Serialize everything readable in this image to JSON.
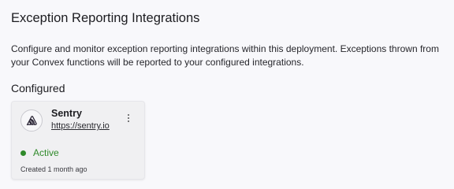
{
  "page": {
    "title": "Exception Reporting Integrations",
    "description": "Configure and monitor exception reporting integrations within this deployment. Exceptions thrown from your Convex functions will be reported to your configured integrations.",
    "section_title": "Configured"
  },
  "integration": {
    "name": "Sentry",
    "link": "https://sentry.io",
    "status": "Active",
    "created": "Created 1 month ago",
    "logo_icon": "sentry-logo-icon",
    "menu_icon": "more-vertical-icon"
  },
  "colors": {
    "status_active": "#2f8a2a",
    "background": "#f8f8fb",
    "card_background": "#f0f0f2"
  }
}
